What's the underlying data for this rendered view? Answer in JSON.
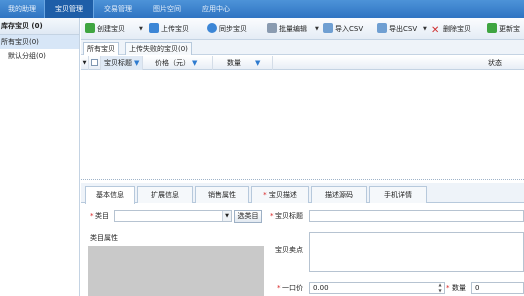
{
  "nav": {
    "items": [
      {
        "label": "我的助理"
      },
      {
        "label": "宝贝管理",
        "active": true
      },
      {
        "label": "交易管理"
      },
      {
        "label": "图片空间"
      },
      {
        "label": "应用中心"
      }
    ]
  },
  "left": {
    "header": "库存宝贝 (0)",
    "items": [
      {
        "label": "所有宝贝(0)",
        "selected": true
      },
      {
        "label": "默认分组(0)"
      }
    ]
  },
  "toolbar": {
    "create": "创建宝贝",
    "upload": "上传宝贝",
    "sync": "同步宝贝",
    "batch_edit": "批量编辑",
    "import_csv": "导入CSV",
    "export_csv": "导出CSV",
    "delete": "删除宝贝",
    "update": "更新宝"
  },
  "subtabs": [
    {
      "label": "所有宝贝",
      "active": true
    },
    {
      "label": "上传失败的宝贝(0)"
    }
  ],
  "grid": {
    "columns": [
      {
        "label": "宝贝标题"
      },
      {
        "label": "价格（元）"
      },
      {
        "label": "数量"
      },
      {
        "label": "状态"
      }
    ]
  },
  "bottom_tabs": [
    {
      "label": "基本信息",
      "active": true
    },
    {
      "label": "扩展信息"
    },
    {
      "label": "销售属性"
    },
    {
      "label": "宝贝描述",
      "required": true
    },
    {
      "label": "描述源码"
    },
    {
      "label": "手机详情"
    }
  ],
  "form": {
    "category_label": "类目",
    "select_category_button": "选类目",
    "category_attrs_label": "类目属性",
    "title_label": "宝贝标题",
    "selling_points_label": "宝贝卖点",
    "price_label": "一口价",
    "price_value": "0.00",
    "quantity_label": "数量",
    "quantity_value": "0",
    "required_mark": "*"
  },
  "colors": {
    "nav_bg": "#2f74c2",
    "accent": "#2e7bcf",
    "required": "#d81e1e"
  }
}
